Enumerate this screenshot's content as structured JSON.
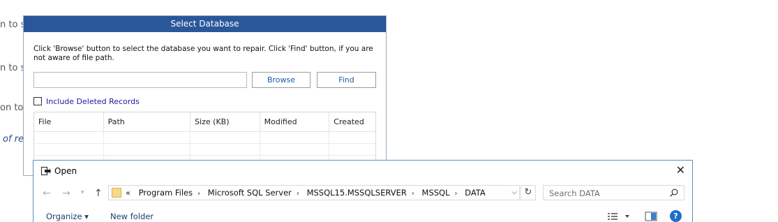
{
  "background": {
    "line1_prefix": "n to ",
    "line1_link": "s",
    "line2_prefix": "n to ",
    "line2_link": "s",
    "line3_prefix": "on to",
    "line4_italic": "of re"
  },
  "select_db_dialog": {
    "title": "Select Database",
    "instruction": "Click 'Browse' button to select the database you want to repair. Click 'Find' button, if you are not aware of file path.",
    "path_value": "",
    "browse_label": "Browse",
    "find_label": "Find",
    "include_deleted_label": "Include Deleted Records",
    "include_deleted_checked": false,
    "columns": [
      "File",
      "Path",
      "Size (KB)",
      "Modified",
      "Created"
    ]
  },
  "open_dialog": {
    "title": "Open",
    "breadcrumb_prefix": "«",
    "breadcrumb": [
      "Program Files",
      "Microsoft SQL Server",
      "MSSQL15.MSSQLSERVER",
      "MSSQL",
      "DATA"
    ],
    "search_placeholder": "Search DATA",
    "organize_label": "Organize ▾",
    "new_folder_label": "New folder",
    "help_glyph": "?",
    "close_glyph": "✕",
    "colors": {
      "help": "#1f6fc8",
      "title_bar": "#2a579a"
    }
  }
}
